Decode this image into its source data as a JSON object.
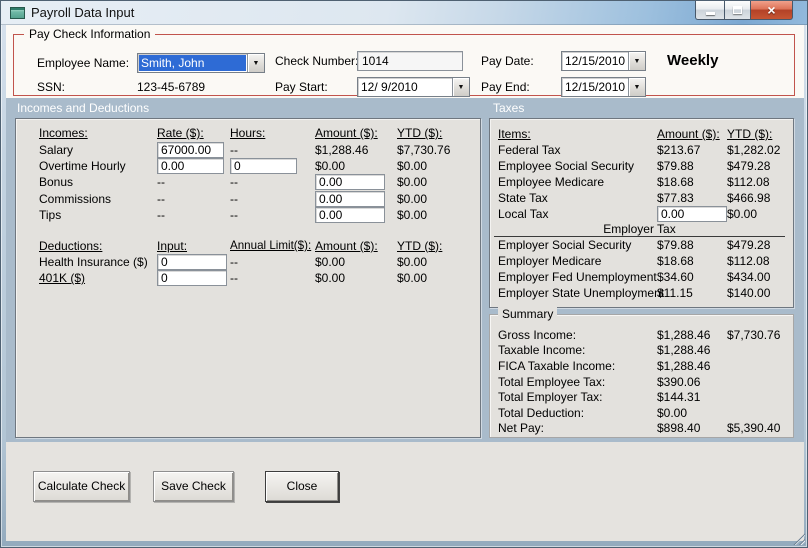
{
  "window": {
    "title": "Payroll Data Input",
    "close_glyph": "×",
    "dropdown_glyph": "▼"
  },
  "colors": {
    "groupbox_border": "#c1544c",
    "section_strip": "#a9bbcb",
    "selection_blue": "#2e6bd5",
    "panel_bg": "#e3e1dd"
  },
  "icons": {
    "titlebar": "form-icon",
    "caption": [
      "minimize-icon",
      "maximize-icon",
      "close-icon"
    ],
    "combos": "chevron-down-icon"
  },
  "paycheck": {
    "box_title": "Pay Check Information",
    "employee_name_label": "Employee Name:",
    "employee_name_value": "Smith, John",
    "ssn_label": "SSN:",
    "ssn_value": "123-45-6789",
    "check_number_label": "Check Number:",
    "check_number_value": "1014",
    "pay_start_label": "Pay Start:",
    "pay_start_value": "12/ 9/2010",
    "pay_date_label": "Pay Date:",
    "pay_date_value": "12/15/2010",
    "pay_end_label": "Pay End:",
    "pay_end_value": "12/15/2010",
    "pay_frequency": "Weekly"
  },
  "incomes_deductions": {
    "section_title": "Incomes and Deductions",
    "income_headers": [
      "Incomes:",
      "Rate ($):",
      "Hours:",
      "Amount ($):",
      "YTD ($):"
    ],
    "income_rows": [
      {
        "label": "Salary",
        "rate": "67000.00",
        "hours": "--",
        "amount": "$1,288.46",
        "ytd": "$7,730.76"
      },
      {
        "label": "Overtime Hourly",
        "rate": "0.00",
        "hours": "0",
        "amount": "$0.00",
        "ytd": "$0.00"
      },
      {
        "label": "Bonus",
        "rate": "--",
        "hours": "--",
        "amount": "0.00",
        "ytd": "$0.00"
      },
      {
        "label": "Commissions",
        "rate": "--",
        "hours": "--",
        "amount": "0.00",
        "ytd": "$0.00"
      },
      {
        "label": "Tips",
        "rate": "--",
        "hours": "--",
        "amount": "0.00",
        "ytd": "$0.00"
      }
    ],
    "deduction_headers": [
      "Deductions:",
      "Input:",
      "Annual Limit($):",
      "Amount ($):",
      "YTD ($):"
    ],
    "deduction_rows": [
      {
        "label": "Health Insurance  ($)",
        "input": "0",
        "limit": "--",
        "amount": "$0.00",
        "ytd": "$0.00"
      },
      {
        "label": "401K  ($)",
        "input": "0",
        "limit": "--",
        "amount": "$0.00",
        "ytd": "$0.00"
      }
    ]
  },
  "taxes": {
    "section_title": "Taxes",
    "headers": [
      "Items:",
      "Amount ($):",
      "YTD ($):"
    ],
    "rows": [
      {
        "label": "Federal Tax",
        "amount": "$213.67",
        "ytd": "$1,282.02"
      },
      {
        "label": "Employee Social Security",
        "amount": "$79.88",
        "ytd": "$479.28"
      },
      {
        "label": "Employee Medicare",
        "amount": "$18.68",
        "ytd": "$112.08"
      },
      {
        "label": "State Tax",
        "amount": "$77.83",
        "ytd": "$466.98"
      },
      {
        "label": "Local Tax",
        "amount": "0.00",
        "ytd": "$0.00"
      }
    ],
    "employer_title": "Employer Tax",
    "employer_rows": [
      {
        "label": "Employer Social Security",
        "amount": "$79.88",
        "ytd": "$479.28"
      },
      {
        "label": "Employer Medicare",
        "amount": "$18.68",
        "ytd": "$112.08"
      },
      {
        "label": "Employer Fed Unemployment",
        "amount": "$34.60",
        "ytd": "$434.00"
      },
      {
        "label": "Employer State Unemployment",
        "amount": "$11.15",
        "ytd": "$140.00"
      }
    ]
  },
  "summary": {
    "box_title": "Summary",
    "rows": [
      {
        "label": "Gross Income:",
        "amount": "$1,288.46",
        "ytd": "$7,730.76"
      },
      {
        "label": "Taxable Income:",
        "amount": "$1,288.46",
        "ytd": ""
      },
      {
        "label": "FICA Taxable Income:",
        "amount": "$1,288.46",
        "ytd": ""
      },
      {
        "label": "Total Employee Tax:",
        "amount": "$390.06",
        "ytd": ""
      },
      {
        "label": "Total Employer Tax:",
        "amount": "$144.31",
        "ytd": ""
      },
      {
        "label": "Total Deduction:",
        "amount": "$0.00",
        "ytd": ""
      },
      {
        "label": "Net Pay:",
        "amount": "$898.40",
        "ytd": "$5,390.40"
      }
    ]
  },
  "action_buttons": {
    "calculate": "Calculate Check",
    "save": "Save Check",
    "close": "Close"
  }
}
